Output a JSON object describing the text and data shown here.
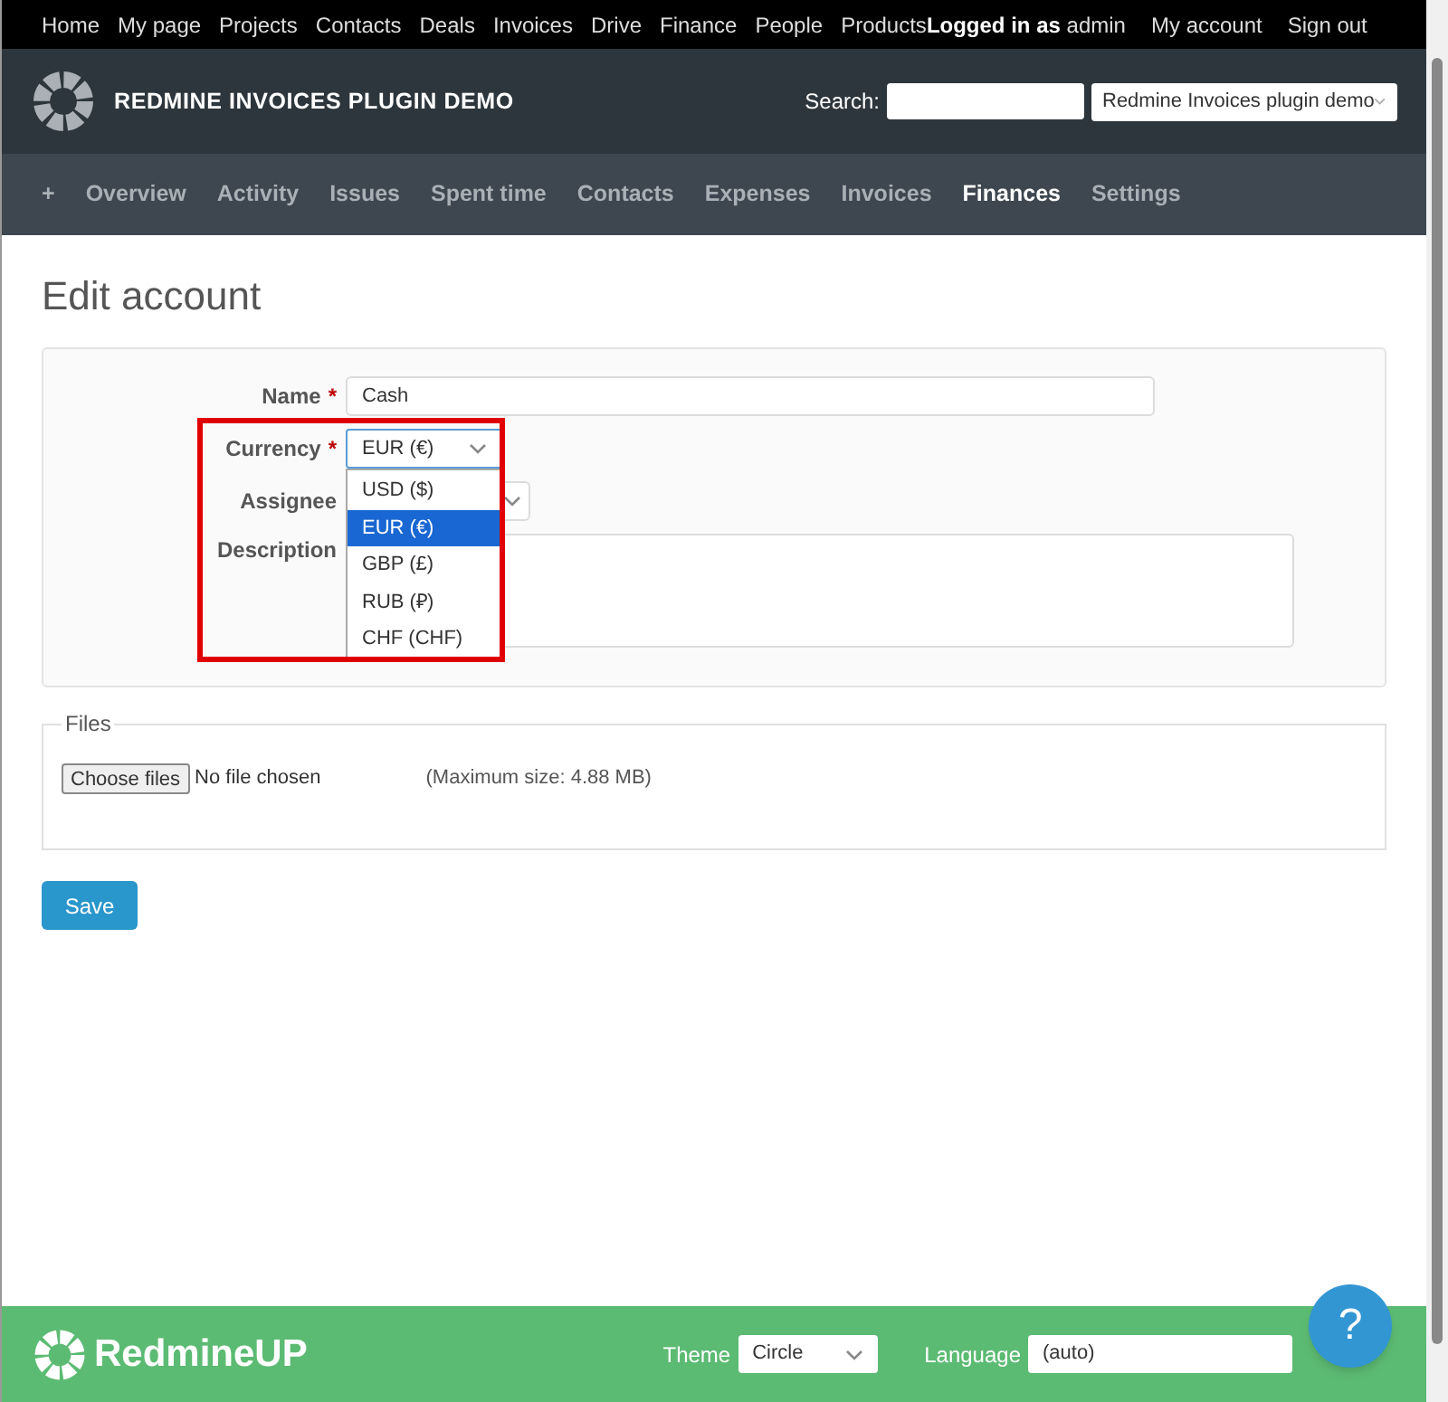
{
  "top_menu": {
    "items": [
      "Home",
      "My page",
      "Projects",
      "Contacts",
      "Deals",
      "Invoices",
      "Drive",
      "Finance",
      "People",
      "Products"
    ],
    "logged_in": {
      "prefix": "Logged in as",
      "user": "admin"
    },
    "account_links": [
      "My account",
      "Sign out"
    ]
  },
  "header": {
    "title": "REDMINE INVOICES PLUGIN DEMO",
    "search_label": "Search:",
    "project_select": "Redmine Invoices plugin demo"
  },
  "main_menu": [
    {
      "label": "+",
      "selected": false
    },
    {
      "label": "Overview",
      "selected": false
    },
    {
      "label": "Activity",
      "selected": false
    },
    {
      "label": "Issues",
      "selected": false
    },
    {
      "label": "Spent time",
      "selected": false
    },
    {
      "label": "Contacts",
      "selected": false
    },
    {
      "label": "Expenses",
      "selected": false
    },
    {
      "label": "Invoices",
      "selected": false
    },
    {
      "label": "Finances",
      "selected": true
    },
    {
      "label": "Settings",
      "selected": false
    }
  ],
  "page_title": "Edit account",
  "form": {
    "fields": [
      {
        "kind": "text",
        "label": "Name",
        "required_mark": "*",
        "value": "Cash"
      },
      {
        "kind": "select",
        "label": "Currency",
        "required_mark": "*",
        "value": "EUR (€)",
        "expanded": true,
        "options": [
          {
            "label": "USD ($)",
            "selected": false
          },
          {
            "label": "EUR (€)",
            "selected": true
          },
          {
            "label": "GBP (£)",
            "selected": false
          },
          {
            "label": "RUB (₽)",
            "selected": false
          },
          {
            "label": "CHF (CHF)",
            "selected": false
          }
        ]
      },
      {
        "kind": "hidden_select",
        "label": "Assignee"
      },
      {
        "kind": "textarea",
        "label": "Description"
      }
    ],
    "highlighted": true
  },
  "files": {
    "legend": "Files",
    "button": "Choose files",
    "status": "No file chosen",
    "max_size": "(Maximum size: 4.88 MB)"
  },
  "save_button": "Save",
  "footer": {
    "brand": "RedmineUP",
    "theme_label": "Theme",
    "theme_value": "Circle",
    "language_label": "Language",
    "language_value": "(auto)"
  },
  "help_button": "?"
}
